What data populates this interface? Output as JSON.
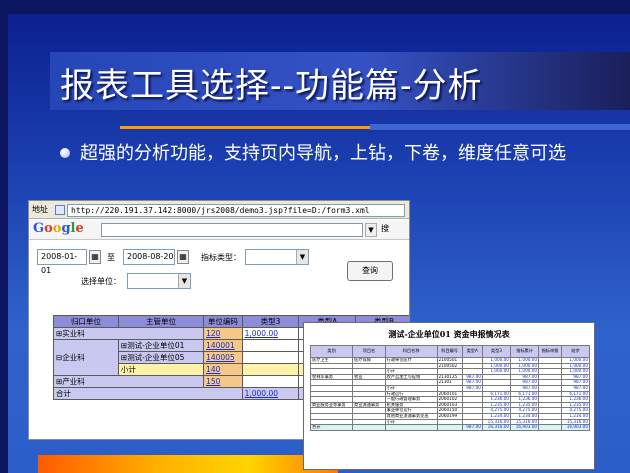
{
  "slide": {
    "title": "报表工具选择--功能篇-分析",
    "bullet": "超强的分析功能，支持页内导航，上钻，下卷，维度任意可选",
    "colors": {
      "background": "#1b3fb0",
      "accent": "#ff9a00",
      "title": "#ffffff"
    }
  },
  "browser": {
    "address_label": "地址",
    "url": "http://220.191.37.142:8000/jrs2008/demo3.jsp?file=D:/form3.xml",
    "google_logo": [
      "G",
      "o",
      "o",
      "g",
      "l",
      "e"
    ],
    "search_label": "搜"
  },
  "form": {
    "date_from": "2008-01-01",
    "to_label": "至",
    "date_to": "2008-08-20",
    "indicator_label": "指标类型：",
    "unit_label": "选择单位：",
    "query_button": "查询"
  },
  "grid": {
    "headers": [
      "归口单位",
      "主管单位",
      "单位编码",
      "类型3",
      "类型A",
      "类型B"
    ],
    "rows": {
      "shiyeke": "实业科",
      "code_120": "120",
      "amount_1000": "1,000.00",
      "qiyeke": "企业科",
      "unit01": "测试-企业单位01",
      "code_140001": "140001",
      "unit05": "测试-企业单位05",
      "code_140005": "140005",
      "subtotal": "小计",
      "code_140": "140",
      "chanyeke": "产业科",
      "code_150": "150",
      "total": "合计",
      "total_amount": "1,000.00"
    }
  },
  "report": {
    "title": "测试-企业单位01 资金申报情况表",
    "headers": [
      "类别",
      "项目名",
      "科目名称",
      "科目编号",
      "类型A",
      "类型3",
      "指标累计",
      "指标申报",
      "结余"
    ],
    "rows": [
      [
        "医疗卫生",
        "医疗保障",
        "行政单位医疗",
        "2100501",
        "",
        "1,000.00",
        "1,000.00",
        "",
        "1,000.00"
      ],
      [
        "",
        "",
        "",
        "2100502",
        "",
        "1,000.00",
        "1,000.00",
        "",
        "1,000.00"
      ],
      [
        "",
        "",
        "小计",
        "",
        "",
        "1,000.00",
        "1,000.00",
        "",
        "1,000.00"
      ],
      [
        "农林水事务",
        "农业",
        "农产品加工与促销",
        "2130125",
        "987.00",
        "",
        "987.00",
        "",
        "987.00"
      ],
      [
        "",
        "",
        "",
        "21301",
        "987.00",
        "",
        "987.00",
        "",
        "987.00"
      ],
      [
        "",
        "",
        "小计",
        "",
        "987.00",
        "",
        "987.00",
        "",
        "987.00"
      ],
      [
        "",
        "",
        "行政运行",
        "2060101",
        "",
        "6,171.00",
        "6,171.00",
        "",
        "6,171.00"
      ],
      [
        "",
        "",
        "一般行政管理事务",
        "2060102",
        "",
        "1,236.00",
        "1,236.00",
        "",
        "1,236.00"
      ],
      [
        "商业服务业等事务",
        "商业流通事务",
        "机关服务",
        "2060103",
        "",
        "1,235.00",
        "1,235.00",
        "",
        "1,235.00"
      ],
      [
        "",
        "",
        "事业单位运行",
        "2060150",
        "",
        "4,275.00",
        "4,275.00",
        "",
        "4,275.00"
      ],
      [
        "",
        "",
        "其他商业流通事务支出",
        "2060199",
        "",
        "1,234.00",
        "1,234.00",
        "",
        "1,234.00"
      ],
      [
        "",
        "",
        "小计",
        "",
        "",
        "15,316.00",
        "15,316.00",
        "",
        "15,316.00"
      ],
      [
        "合计",
        "",
        "",
        "",
        "987.00",
        "16,316.00",
        "16,903.00",
        "",
        "16,903.00"
      ]
    ]
  }
}
